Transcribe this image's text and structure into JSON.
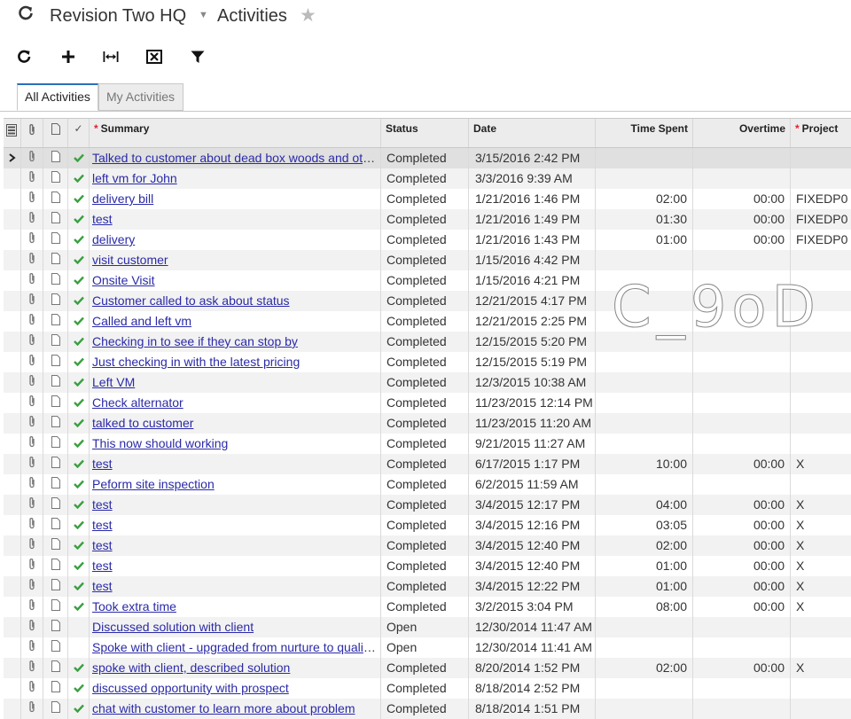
{
  "header": {
    "company": "Revision Two HQ",
    "page_title": "Activities"
  },
  "tabs": [
    {
      "label": "All Activities",
      "active": true
    },
    {
      "label": "My Activities",
      "active": false
    }
  ],
  "columns": {
    "summary": "Summary",
    "status": "Status",
    "date": "Date",
    "time_spent": "Time Spent",
    "overtime": "Overtime",
    "project": "Project"
  },
  "rows": [
    {
      "summary": "Talked to customer about dead box woods and other stuff",
      "status": "Completed",
      "date": "3/15/2016 2:42 PM",
      "time_spent": "",
      "overtime": "",
      "project": "",
      "done": true,
      "selected": true
    },
    {
      "summary": "left vm for John",
      "status": "Completed",
      "date": "3/3/2016 9:39 AM",
      "time_spent": "",
      "overtime": "",
      "project": "",
      "done": true
    },
    {
      "summary": "delivery bill",
      "status": "Completed",
      "date": "1/21/2016 1:46 PM",
      "time_spent": "02:00",
      "overtime": "00:00",
      "project": "FIXEDP0",
      "done": true
    },
    {
      "summary": "test",
      "status": "Completed",
      "date": "1/21/2016 1:49 PM",
      "time_spent": "01:30",
      "overtime": "00:00",
      "project": "FIXEDP0",
      "done": true
    },
    {
      "summary": "delivery",
      "status": "Completed",
      "date": "1/21/2016 1:43 PM",
      "time_spent": "01:00",
      "overtime": "00:00",
      "project": "FIXEDP0",
      "done": true
    },
    {
      "summary": "visit customer",
      "status": "Completed",
      "date": "1/15/2016 4:42 PM",
      "time_spent": "",
      "overtime": "",
      "project": "",
      "done": true
    },
    {
      "summary": "Onsite Visit",
      "status": "Completed",
      "date": "1/15/2016 4:21 PM",
      "time_spent": "",
      "overtime": "",
      "project": "",
      "done": true
    },
    {
      "summary": "Customer called to ask about status",
      "status": "Completed",
      "date": "12/21/2015 4:17 PM",
      "time_spent": "",
      "overtime": "",
      "project": "",
      "done": true
    },
    {
      "summary": "Called and left vm",
      "status": "Completed",
      "date": "12/21/2015 2:25 PM",
      "time_spent": "",
      "overtime": "",
      "project": "",
      "done": true
    },
    {
      "summary": "Checking in to see if they can stop by",
      "status": "Completed",
      "date": "12/15/2015 5:20 PM",
      "time_spent": "",
      "overtime": "",
      "project": "",
      "done": true
    },
    {
      "summary": "Just checking in with the latest pricing",
      "status": "Completed",
      "date": "12/15/2015 5:19 PM",
      "time_spent": "",
      "overtime": "",
      "project": "",
      "done": true
    },
    {
      "summary": "Left VM",
      "status": "Completed",
      "date": "12/3/2015 10:38 AM",
      "time_spent": "",
      "overtime": "",
      "project": "",
      "done": true
    },
    {
      "summary": "Check alternator",
      "status": "Completed",
      "date": "11/23/2015 12:14 PM",
      "time_spent": "",
      "overtime": "",
      "project": "",
      "done": true
    },
    {
      "summary": "talked to customer",
      "status": "Completed",
      "date": "11/23/2015 11:20 AM",
      "time_spent": "",
      "overtime": "",
      "project": "",
      "done": true
    },
    {
      "summary": "This now should working",
      "status": "Completed",
      "date": "9/21/2015 11:27 AM",
      "time_spent": "",
      "overtime": "",
      "project": "",
      "done": true
    },
    {
      "summary": "test",
      "status": "Completed",
      "date": "6/17/2015 1:17 PM",
      "time_spent": "10:00",
      "overtime": "00:00",
      "project": "X",
      "done": true
    },
    {
      "summary": "Peform site inspection",
      "status": "Completed",
      "date": "6/2/2015 11:59 AM",
      "time_spent": "",
      "overtime": "",
      "project": "",
      "done": true
    },
    {
      "summary": "test",
      "status": "Completed",
      "date": "3/4/2015 12:17 PM",
      "time_spent": "04:00",
      "overtime": "00:00",
      "project": "X",
      "done": true
    },
    {
      "summary": "test",
      "status": "Completed",
      "date": "3/4/2015 12:16 PM",
      "time_spent": "03:05",
      "overtime": "00:00",
      "project": "X",
      "done": true
    },
    {
      "summary": "test",
      "status": "Completed",
      "date": "3/4/2015 12:40 PM",
      "time_spent": "02:00",
      "overtime": "00:00",
      "project": "X",
      "done": true
    },
    {
      "summary": "test",
      "status": "Completed",
      "date": "3/4/2015 12:40 PM",
      "time_spent": "01:00",
      "overtime": "00:00",
      "project": "X",
      "done": true
    },
    {
      "summary": "test",
      "status": "Completed",
      "date": "3/4/2015 12:22 PM",
      "time_spent": "01:00",
      "overtime": "00:00",
      "project": "X",
      "done": true
    },
    {
      "summary": "Took extra time",
      "status": "Completed",
      "date": "3/2/2015 3:04 PM",
      "time_spent": "08:00",
      "overtime": "00:00",
      "project": "X",
      "done": true
    },
    {
      "summary": "Discussed solution with client",
      "status": "Open",
      "date": "12/30/2014 11:47 AM",
      "time_spent": "",
      "overtime": "",
      "project": "",
      "done": false
    },
    {
      "summary": "Spoke with client - upgraded from nurture to qualified",
      "status": "Open",
      "date": "12/30/2014 11:41 AM",
      "time_spent": "",
      "overtime": "",
      "project": "",
      "done": false
    },
    {
      "summary": "spoke with client, described solution",
      "status": "Completed",
      "date": "8/20/2014 1:52 PM",
      "time_spent": "02:00",
      "overtime": "00:00",
      "project": "X",
      "done": true
    },
    {
      "summary": "discussed opportunity with prospect",
      "status": "Completed",
      "date": "8/18/2014 2:52 PM",
      "time_spent": "",
      "overtime": "",
      "project": "",
      "done": true
    },
    {
      "summary": "chat with customer to learn more about problem",
      "status": "Completed",
      "date": "8/18/2014 1:51 PM",
      "time_spent": "",
      "overtime": "",
      "project": "",
      "done": true
    }
  ],
  "colors": {
    "link": "#2a2aa8",
    "check": "#3aa040",
    "required": "#dd2233",
    "tab_accent": "#2a6fb8"
  },
  "icons": [
    "refresh-icon",
    "caret-down-icon",
    "star-icon",
    "refresh-icon",
    "plus-icon",
    "fit-width-icon",
    "export-excel-icon",
    "filter-icon",
    "paperclip-icon",
    "document-icon",
    "checkmark-icon",
    "row-pointer-icon"
  ]
}
